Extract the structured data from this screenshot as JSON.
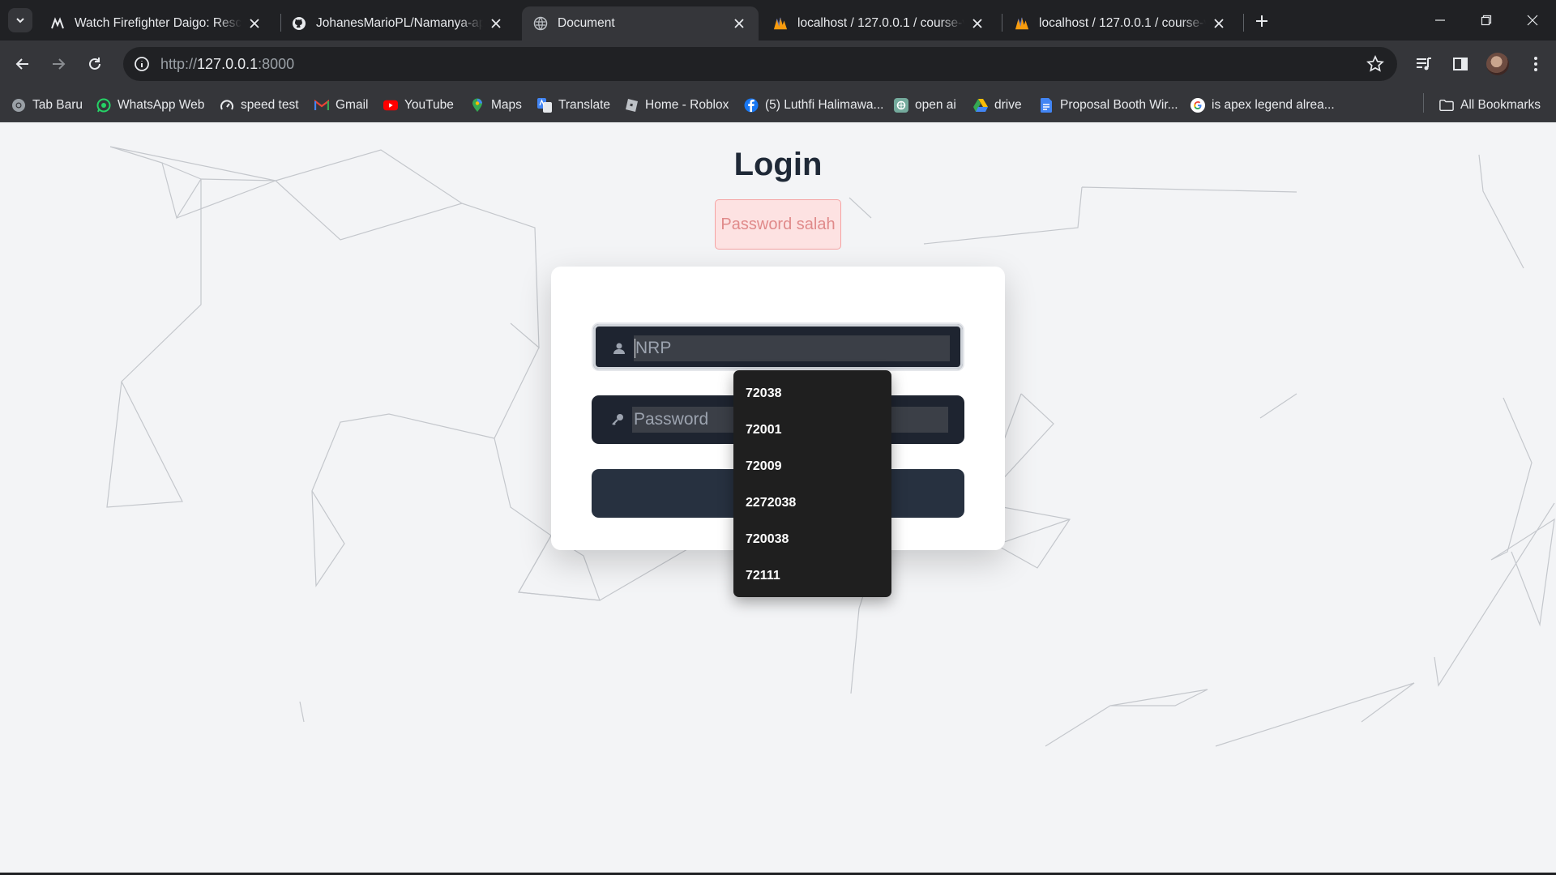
{
  "browser": {
    "tabs": [
      {
        "title": "Watch Firefighter Daigo: Rescuer",
        "icon": "streaming-site-icon",
        "active": false
      },
      {
        "title": "JohanesMarioPL/Namanya-apa",
        "icon": "github-icon",
        "active": false
      },
      {
        "title": "Document",
        "icon": "globe-icon",
        "active": true
      },
      {
        "title": "localhost / 127.0.0.1 / course-vo",
        "icon": "phpmyadmin-icon",
        "active": false
      },
      {
        "title": "localhost / 127.0.0.1 / course-vo",
        "icon": "phpmyadmin-icon",
        "active": false
      }
    ],
    "address": {
      "scheme": "http://",
      "host": "127.0.0.1",
      "port": ":8000"
    },
    "bookmarks": [
      {
        "label": "Tab Baru",
        "icon": "chrome-icon"
      },
      {
        "label": "WhatsApp Web",
        "icon": "whatsapp-icon"
      },
      {
        "label": "speed test",
        "icon": "speedometer-icon"
      },
      {
        "label": "Gmail",
        "icon": "gmail-icon"
      },
      {
        "label": "YouTube",
        "icon": "youtube-icon"
      },
      {
        "label": "Maps",
        "icon": "maps-pin-icon"
      },
      {
        "label": "Translate",
        "icon": "translate-icon"
      },
      {
        "label": "Home - Roblox",
        "icon": "roblox-icon"
      },
      {
        "label": "(5) Luthfi Halimawa...",
        "icon": "facebook-icon"
      },
      {
        "label": "open ai",
        "icon": "openai-icon"
      },
      {
        "label": "drive",
        "icon": "google-drive-icon"
      },
      {
        "label": "Proposal Booth Wir...",
        "icon": "google-docs-icon"
      },
      {
        "label": "is apex legend alrea...",
        "icon": "google-icon"
      }
    ],
    "all_bookmarks_label": "All Bookmarks"
  },
  "page": {
    "title": "Login",
    "alert": "Password salah",
    "nrp_placeholder": "NRP",
    "password_placeholder": "Password",
    "autocomplete": [
      "72038",
      "72001",
      "72009",
      "2272038",
      "720038",
      "72111"
    ]
  },
  "colors": {
    "page_bg": "#f3f4f6",
    "field_bg": "#1e2430",
    "button_bg": "#273140",
    "alert_bg": "#fde2e2",
    "alert_text": "#e08a8a"
  }
}
